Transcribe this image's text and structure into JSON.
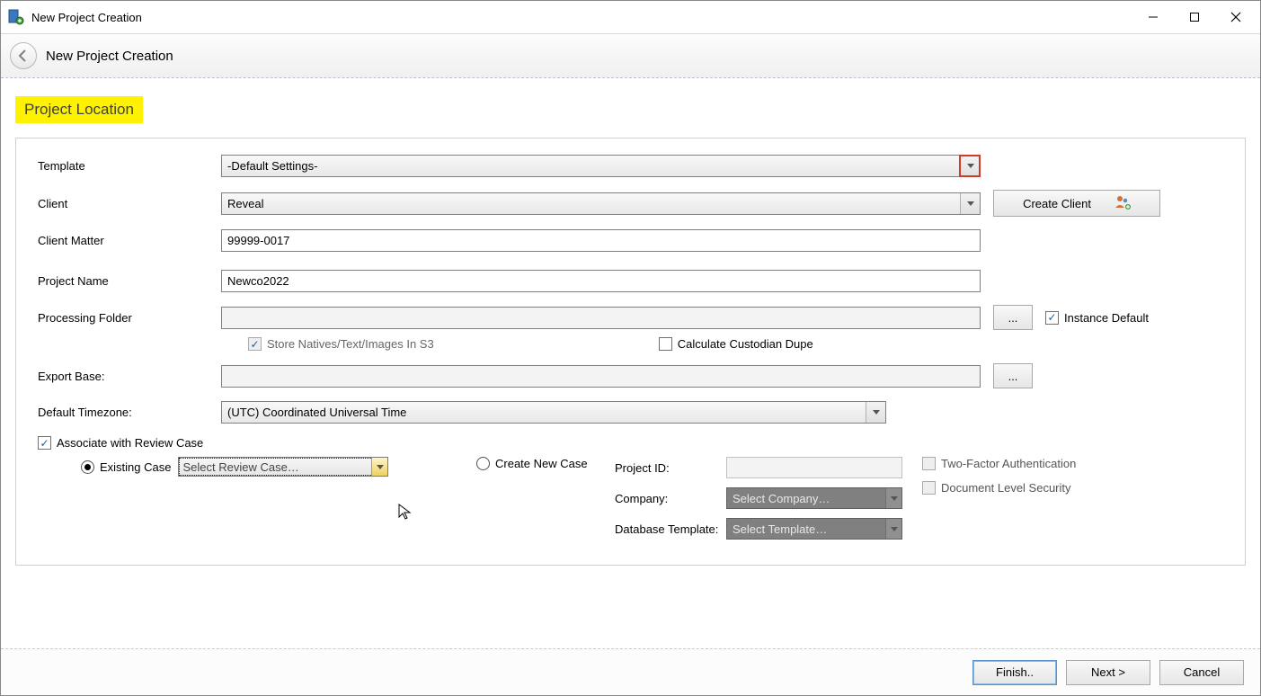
{
  "window": {
    "title": "New Project Creation"
  },
  "header": {
    "title": "New Project Creation"
  },
  "section": {
    "title": "Project Location"
  },
  "labels": {
    "template": "Template",
    "client": "Client",
    "client_matter": "Client Matter",
    "project_name": "Project Name",
    "processing_folder": "Processing Folder",
    "export_base": "Export Base:",
    "default_timezone": "Default Timezone:",
    "associate": "Associate with Review Case",
    "store_natives": "Store Natives/Text/Images In S3",
    "calc_dupe": "Calculate Custodian Dupe",
    "instance_default": "Instance Default",
    "existing_case": "Existing Case",
    "create_new_case": "Create New Case",
    "project_id": "Project ID:",
    "company": "Company:",
    "db_template": "Database Template:",
    "two_factor": "Two-Factor Authentication",
    "doc_security": "Document Level Security"
  },
  "values": {
    "template": "-Default Settings-",
    "client": "Reveal",
    "client_matter": "99999-0017",
    "project_name": "Newco2022",
    "processing_folder": "",
    "export_base": "",
    "default_timezone": "(UTC) Coordinated Universal Time",
    "select_review_placeholder": "Select Review Case…",
    "company_placeholder": "Select Company…",
    "db_template_placeholder": "Select Template…",
    "project_id": ""
  },
  "buttons": {
    "create_client": "Create Client",
    "browse": "...",
    "finish": "Finish..",
    "next": "Next >",
    "cancel": "Cancel"
  },
  "state": {
    "store_natives_checked": true,
    "calc_dupe_checked": false,
    "instance_default_checked": true,
    "associate_checked": true,
    "existing_selected": true,
    "two_factor_checked": false,
    "doc_security_checked": false
  }
}
